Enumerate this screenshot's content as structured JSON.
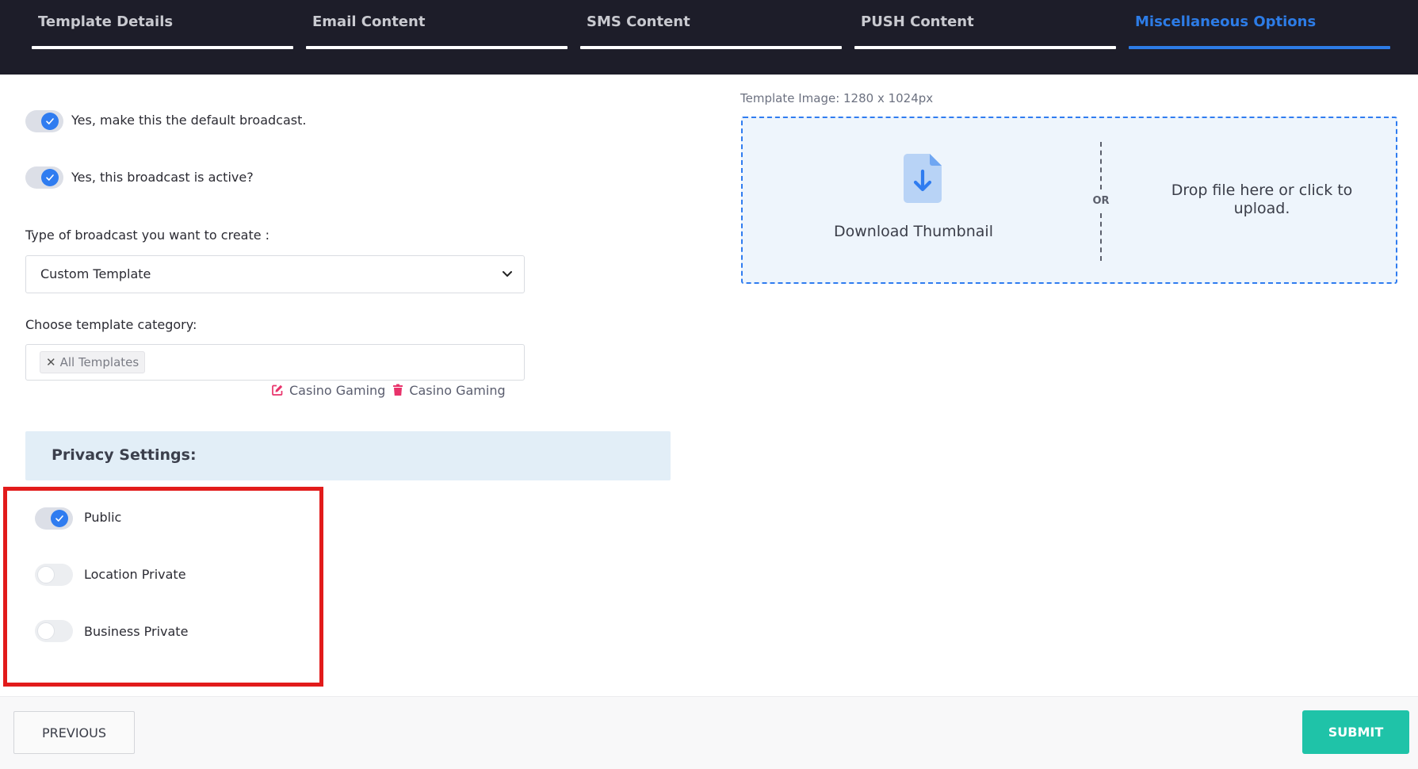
{
  "tabs": [
    {
      "label": "Template Details",
      "active": false
    },
    {
      "label": "Email Content",
      "active": false
    },
    {
      "label": "SMS Content",
      "active": false
    },
    {
      "label": "PUSH Content",
      "active": false
    },
    {
      "label": "Miscellaneous Options",
      "active": true
    }
  ],
  "options": {
    "default_broadcast": {
      "label": "Yes, make this the default broadcast.",
      "checked": true
    },
    "active_broadcast": {
      "label": "Yes, this broadcast is active?",
      "checked": true
    }
  },
  "broadcast_type": {
    "label": "Type of broadcast you want to create :",
    "selected": "Custom Template"
  },
  "template_category": {
    "label": "Choose template category:",
    "tags": [
      "All Templates"
    ],
    "remove_symbol": "✕",
    "edit_action_label": "Casino Gaming",
    "delete_action_label": "Casino Gaming"
  },
  "privacy": {
    "title": "Privacy Settings:",
    "items": [
      {
        "label": "Public",
        "checked": true
      },
      {
        "label": "Location Private",
        "checked": false
      },
      {
        "label": "Business Private",
        "checked": false
      }
    ]
  },
  "upload": {
    "caption": "Template Image: 1280 x 1024px",
    "download_label": "Download Thumbnail",
    "or_label": "OR",
    "drop_label": "Drop file here or click to upload."
  },
  "footer": {
    "previous_label": "PREVIOUS",
    "submit_label": "SUBMIT"
  },
  "colors": {
    "accent": "#2f7cf0",
    "header_bg": "#1d1d29",
    "submit": "#1fc3a8",
    "highlight": "#e21b1b",
    "danger": "#e8336b"
  },
  "icons": {
    "check": "check-icon",
    "select_arrow": "chevron-down-icon",
    "edit": "edit-icon",
    "delete": "trash-icon",
    "download": "file-download-icon"
  }
}
